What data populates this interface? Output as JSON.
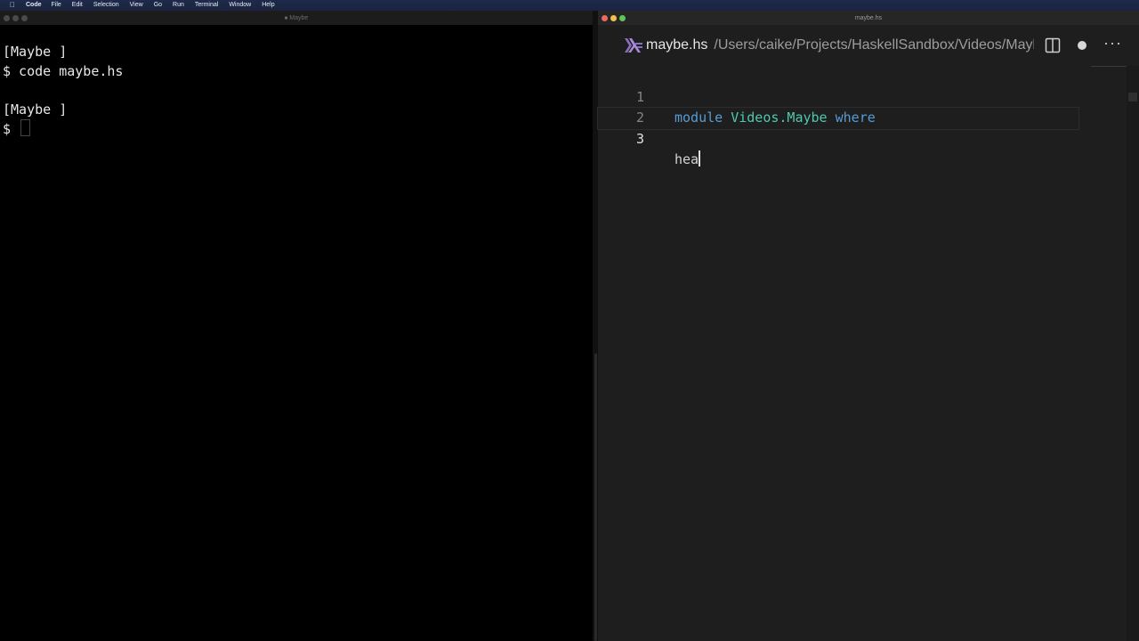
{
  "menubar": {
    "app": "Code",
    "items": [
      "File",
      "Edit",
      "Selection",
      "View",
      "Go",
      "Run",
      "Terminal",
      "Window",
      "Help"
    ]
  },
  "terminal": {
    "title": "Maybe",
    "lines": [
      "[Maybe ]",
      "$ code maybe.hs",
      "",
      "[Maybe ]",
      "$ "
    ]
  },
  "editor": {
    "window_title": "maybe.hs",
    "tab": {
      "name": "maybe.hs",
      "path": "/Users/caike/Projects/HaskellSandbox/Videos/Maybe"
    },
    "lines": [
      {
        "num": "1",
        "kw1": "module",
        "mod": "Videos.Maybe",
        "kw2": "where"
      },
      {
        "num": "2"
      },
      {
        "num": "3",
        "text": "hea"
      }
    ],
    "colors": {
      "keyword": "#569cd6",
      "module": "#4ec9b0",
      "background": "#1e1e1e"
    }
  }
}
